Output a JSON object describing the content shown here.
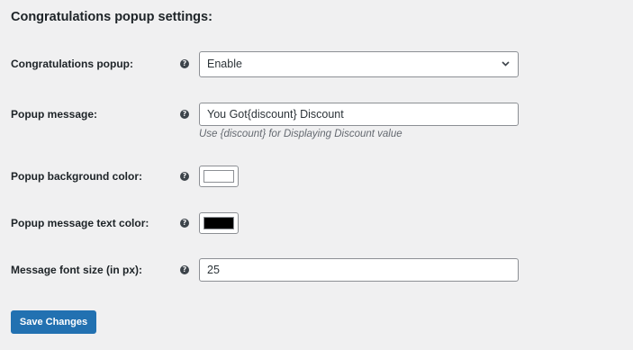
{
  "section": {
    "title": "Congratulations popup settings:"
  },
  "fields": {
    "popup": {
      "label": "Congratulations popup:",
      "value": "Enable"
    },
    "message": {
      "label": "Popup message:",
      "value": "You Got{discount} Discount",
      "hint": "Use {discount} for Displaying Discount value"
    },
    "bg_color": {
      "label": "Popup background color:",
      "color": "#ffffff"
    },
    "text_color": {
      "label": "Popup message text color:",
      "color": "#000000"
    },
    "font_size": {
      "label": "Message font size (in px):",
      "value": "25"
    }
  },
  "help_icon_glyph": "?",
  "actions": {
    "save_label": "Save Changes"
  },
  "colors": {
    "accent": "#2271b1",
    "background": "#f0f0f1"
  }
}
